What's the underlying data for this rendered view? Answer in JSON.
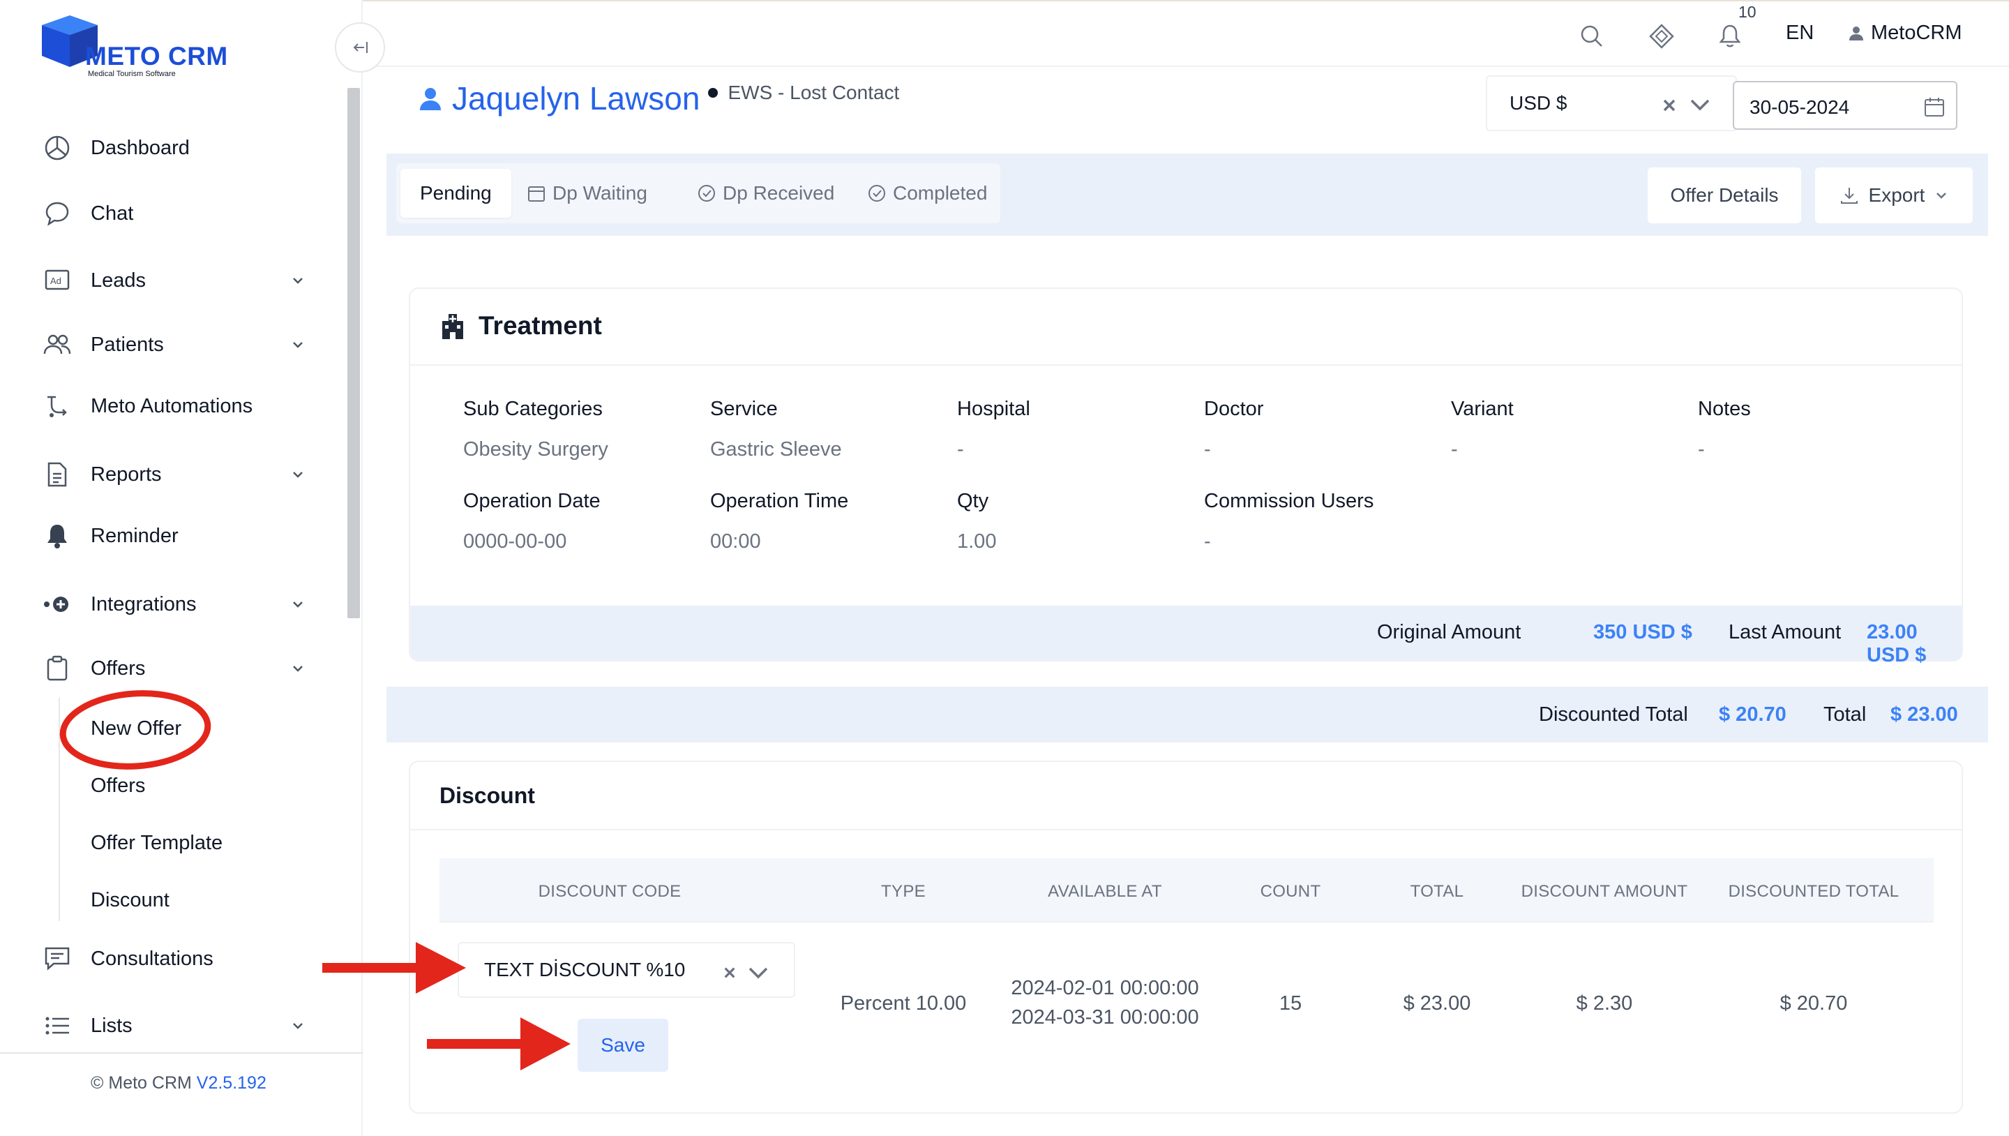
{
  "app": {
    "logo_title": "METO CRM",
    "logo_subtitle": "Medical Tourism Software",
    "copyright_prefix": "© Meto CRM",
    "version": "V2.5.192"
  },
  "colors": {
    "accent": "#2563eb",
    "amount": "#3b82f6",
    "annotation": "#e3261b"
  },
  "sidebar": {
    "items": [
      {
        "label": "Dashboard",
        "icon": "dashboard-icon"
      },
      {
        "label": "Chat",
        "icon": "chat-icon"
      },
      {
        "label": "Leads",
        "icon": "ad-icon"
      },
      {
        "label": "Patients",
        "icon": "users-icon"
      },
      {
        "label": "Meto Automations",
        "icon": "automation-icon"
      },
      {
        "label": "Reports",
        "icon": "document-icon"
      },
      {
        "label": "Reminder",
        "icon": "bell-icon"
      },
      {
        "label": "Integrations",
        "icon": "integration-icon"
      },
      {
        "label": "Offers",
        "icon": "clipboard-icon"
      },
      {
        "label": "Consultations",
        "icon": "message-icon"
      },
      {
        "label": "Lists",
        "icon": "list-icon"
      }
    ],
    "offers_sub": [
      "New Offer",
      "Offers",
      "Offer Template",
      "Discount"
    ]
  },
  "topbar": {
    "notification_count": "10",
    "language": "EN",
    "user": "MetoCRM"
  },
  "patient": {
    "name": "Jaquelyn Lawson",
    "status": "EWS - Lost Contact"
  },
  "filters": {
    "currency": "USD $",
    "date": "30-05-2024"
  },
  "tabs": [
    "Pending",
    "Dp Waiting",
    "Dp Received",
    "Completed"
  ],
  "actions": {
    "offer_details": "Offer Details",
    "export": "Export"
  },
  "treatment": {
    "title": "Treatment",
    "row1_labels": [
      "Sub Categories",
      "Service",
      "Hospital",
      "Doctor",
      "Variant",
      "Notes"
    ],
    "row1_values": [
      "Obesity Surgery",
      "Gastric Sleeve",
      "-",
      "-",
      "-",
      "-"
    ],
    "row2_labels": [
      "Operation Date",
      "Operation Time",
      "Qty",
      "Commission Users"
    ],
    "row2_values": [
      "0000-00-00",
      "00:00",
      "1.00",
      "-"
    ],
    "original_amount_label": "Original Amount",
    "original_amount": "350 USD $",
    "last_amount_label": "Last Amount",
    "last_amount": "23.00 USD $"
  },
  "totals": {
    "discounted_total_label": "Discounted Total",
    "discounted_total": "$ 20.70",
    "total_label": "Total",
    "total": "$ 23.00"
  },
  "discount": {
    "title": "Discount",
    "columns": [
      "DISCOUNT CODE",
      "TYPE",
      "AVAILABLE AT",
      "COUNT",
      "TOTAL",
      "DISCOUNT AMOUNT",
      "DISCOUNTED TOTAL"
    ],
    "row": {
      "code": "TEXT DİSCOUNT %10",
      "type": "Percent 10.00",
      "available_from": "2024-02-01 00:00:00",
      "available_to": "2024-03-31 00:00:00",
      "count": "15",
      "total": "$ 23.00",
      "discount_amount": "$ 2.30",
      "discounted_total": "$ 20.70"
    },
    "save_label": "Save"
  }
}
